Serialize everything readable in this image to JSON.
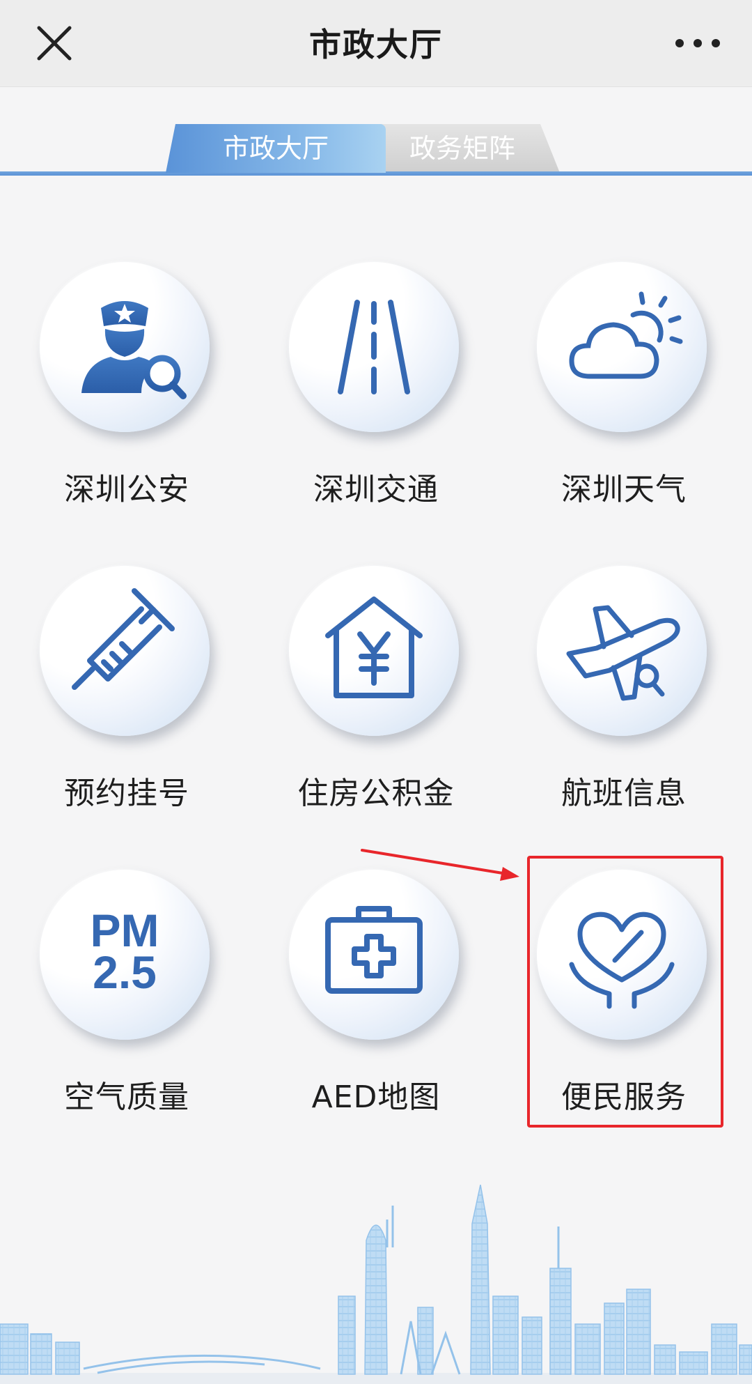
{
  "header": {
    "title": "市政大厅",
    "close_icon": "close-icon",
    "more_icon": "more-icon"
  },
  "tabs": [
    {
      "label": "市政大厅",
      "active": true
    },
    {
      "label": "政务矩阵",
      "active": false
    }
  ],
  "services": [
    {
      "label": "深圳公安",
      "icon": "police-search-icon"
    },
    {
      "label": "深圳交通",
      "icon": "road-icon"
    },
    {
      "label": "深圳天气",
      "icon": "weather-icon"
    },
    {
      "label": "预约挂号",
      "icon": "syringe-icon"
    },
    {
      "label": "住房公积金",
      "icon": "house-yuan-icon"
    },
    {
      "label": "航班信息",
      "icon": "airplane-icon"
    },
    {
      "label": "空气质量",
      "icon": "pm25-icon",
      "icon_text_line1": "PM",
      "icon_text_line2": "2.5"
    },
    {
      "label": "AED地图",
      "icon": "first-aid-kit-icon"
    },
    {
      "label": "便民服务",
      "icon": "heart-hands-icon"
    }
  ],
  "highlight": {
    "target": "便民服务",
    "color": "#e8262b"
  },
  "colors": {
    "accent_blue": "#3f76bd",
    "tab_active": "#5a93d8",
    "highlight_red": "#e8262b"
  }
}
